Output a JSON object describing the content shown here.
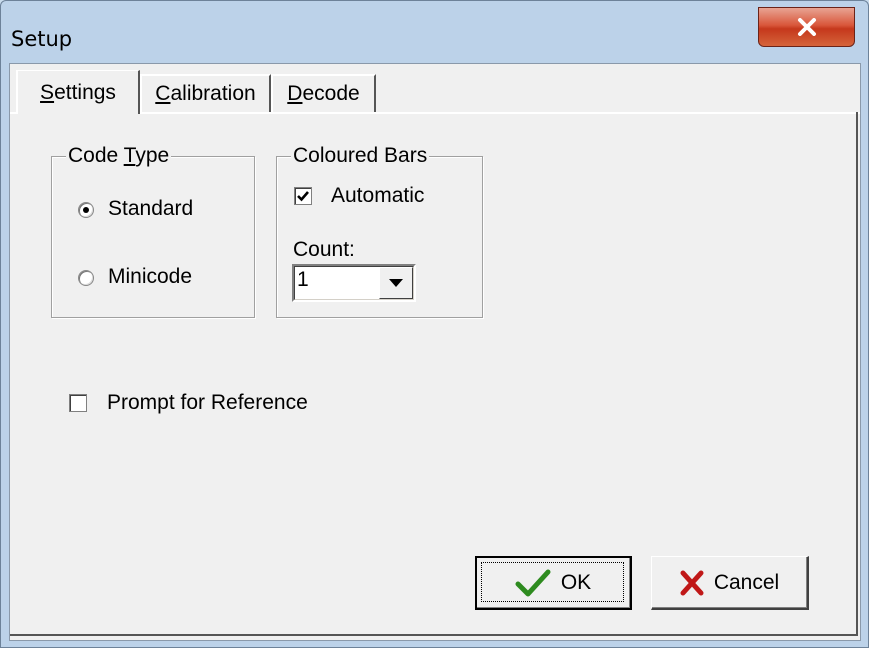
{
  "window": {
    "title": "Setup",
    "close_glyph": "X"
  },
  "tabs": [
    {
      "label": "Settings",
      "mnemonic": "S",
      "rest": "ettings",
      "active": true
    },
    {
      "label": "Calibration",
      "mnemonic": "C",
      "rest": "alibration",
      "active": false
    },
    {
      "label": "Decode",
      "mnemonic": "D",
      "rest": "ecode",
      "active": false
    }
  ],
  "code_type": {
    "legend_pre": "Code ",
    "legend_mnemonic": "T",
    "legend_post": "ype",
    "options": [
      {
        "label": "Standard",
        "selected": true
      },
      {
        "label": "Minicode",
        "selected": false
      }
    ]
  },
  "coloured_bars": {
    "legend": "Coloured Bars",
    "automatic_label": "Automatic",
    "automatic_checked": true,
    "count_label": "Count:",
    "count_value": "1"
  },
  "prompt_reference": {
    "label": "Prompt for Reference",
    "checked": false
  },
  "buttons": {
    "ok_label": "OK",
    "cancel_label": "Cancel"
  },
  "icons": {
    "ok": "checkmark-icon",
    "cancel": "red-x-icon",
    "combo": "dropdown-arrow-icon",
    "close": "close-icon"
  },
  "colors": {
    "close_button": "#c5381c",
    "ok_check": "#2e8b1f",
    "cancel_x": "#c01818"
  }
}
